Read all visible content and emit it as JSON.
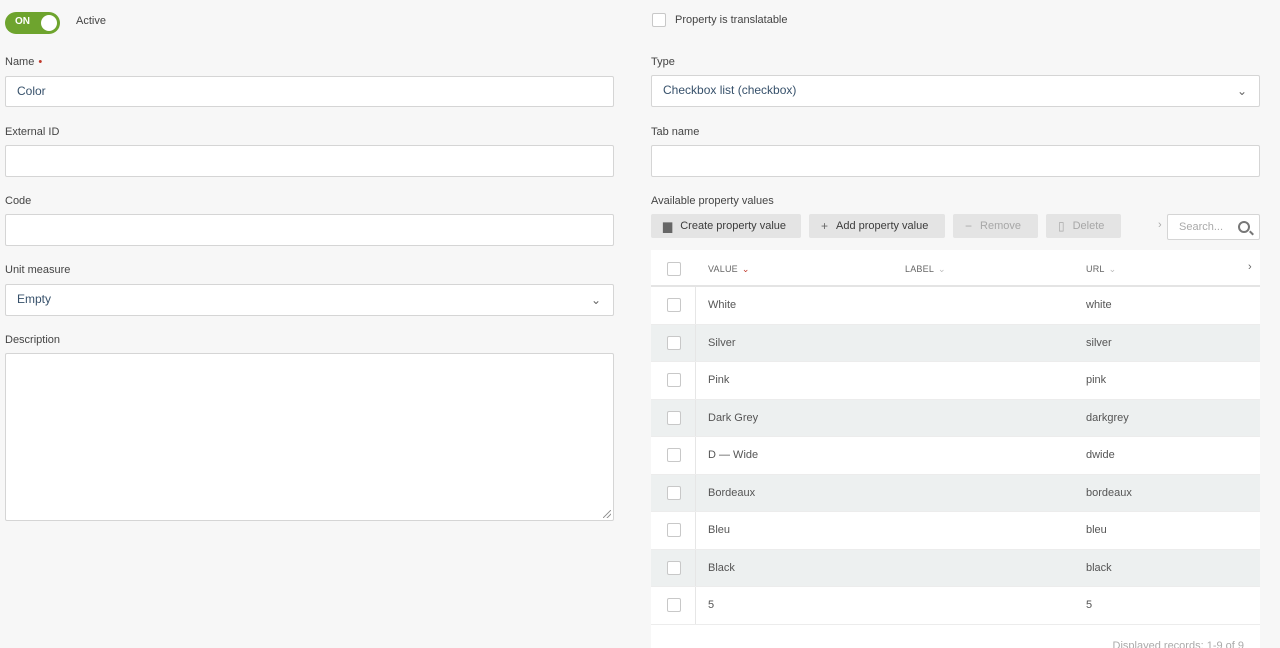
{
  "active": {
    "toggle_label": "ON",
    "label": "Active"
  },
  "translatable": {
    "label": "Property is translatable"
  },
  "name": {
    "label": "Name",
    "required_mark": "•",
    "value": "Color"
  },
  "external_id": {
    "label": "External ID",
    "value": ""
  },
  "code": {
    "label": "Code",
    "value": ""
  },
  "unit_measure": {
    "label": "Unit measure",
    "value": "Empty"
  },
  "description": {
    "label": "Description",
    "value": ""
  },
  "type": {
    "label": "Type",
    "value": "Checkbox list (checkbox)"
  },
  "tab_name": {
    "label": "Tab name",
    "value": ""
  },
  "values_section": {
    "label": "Available property values",
    "buttons": {
      "create": "Create property value",
      "add": "Add property value",
      "remove": "Remove",
      "delete": "Delete"
    },
    "search_placeholder": "Search..."
  },
  "table": {
    "columns": {
      "value": "VALUE",
      "label": "LABEL",
      "url": "URL"
    },
    "rows": [
      {
        "value": "White",
        "label": "",
        "url": "white"
      },
      {
        "value": "Silver",
        "label": "",
        "url": "silver"
      },
      {
        "value": "Pink",
        "label": "",
        "url": "pink"
      },
      {
        "value": "Dark Grey",
        "label": "",
        "url": "darkgrey"
      },
      {
        "value": "D — Wide",
        "label": "",
        "url": "dwide"
      },
      {
        "value": "Bordeaux",
        "label": "",
        "url": "bordeaux"
      },
      {
        "value": "Bleu",
        "label": "",
        "url": "bleu"
      },
      {
        "value": "Black",
        "label": "",
        "url": "black"
      },
      {
        "value": "5",
        "label": "",
        "url": "5"
      }
    ],
    "footer": "Displayed records: 1-9 of 9"
  },
  "colors": {
    "toggle_on": "#6ea42e",
    "required": "#c0392b",
    "row_alt": "#edf0f0"
  }
}
